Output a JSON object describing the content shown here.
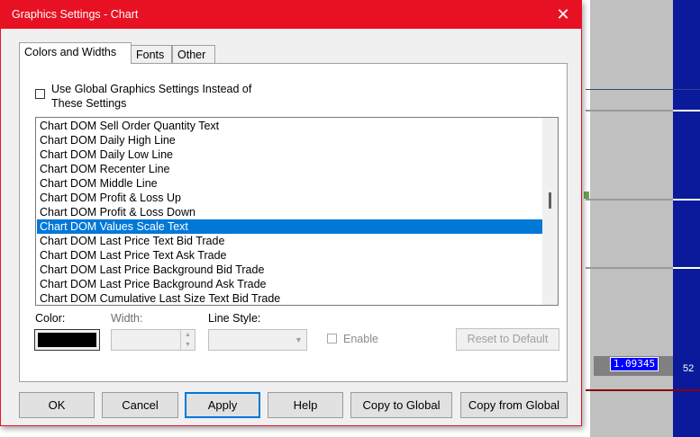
{
  "window": {
    "title": "Graphics Settings  - Chart",
    "close_glyph": "✕"
  },
  "tabs": [
    {
      "label": "Colors and Widths",
      "active": true
    },
    {
      "label": "Fonts",
      "active": false
    },
    {
      "label": "Other",
      "active": false
    }
  ],
  "global_checkbox": {
    "label": "Use Global Graphics Settings Instead of These Settings",
    "checked": false
  },
  "list": {
    "items": [
      "Chart DOM Sell Order Quantity Text",
      "Chart DOM Daily High Line",
      "Chart DOM Daily Low Line",
      "Chart DOM Recenter Line",
      "Chart DOM Middle Line",
      "Chart DOM Profit & Loss Up",
      "Chart DOM Profit & Loss Down",
      "Chart DOM Values Scale Text",
      "Chart DOM Last Price Text Bid Trade",
      "Chart DOM Last Price Text Ask Trade",
      "Chart DOM Last Price Background Bid Trade",
      "Chart DOM Last Price Background Ask Trade",
      "Chart DOM Cumulative Last Size Text Bid Trade"
    ],
    "selected_index": 7
  },
  "fields": {
    "color_label": "Color:",
    "color_value": "#000000",
    "width_label": "Width:",
    "width_value": "",
    "line_style_label": "Line Style:",
    "line_style_value": "",
    "enable_label": "Enable",
    "reset_label": "Reset to Default"
  },
  "buttons": {
    "ok": "OK",
    "cancel": "Cancel",
    "apply": "Apply",
    "help": "Help",
    "copy_to_global": "Copy to Global",
    "copy_from_global": "Copy from Global"
  },
  "background": {
    "price_label": "1.09345",
    "side_number": "52"
  },
  "colors": {
    "title_bar": "#e81123",
    "selection": "#0078d7",
    "price_label_bg": "#0000ff",
    "axis_blue": "#0a1a9a"
  }
}
